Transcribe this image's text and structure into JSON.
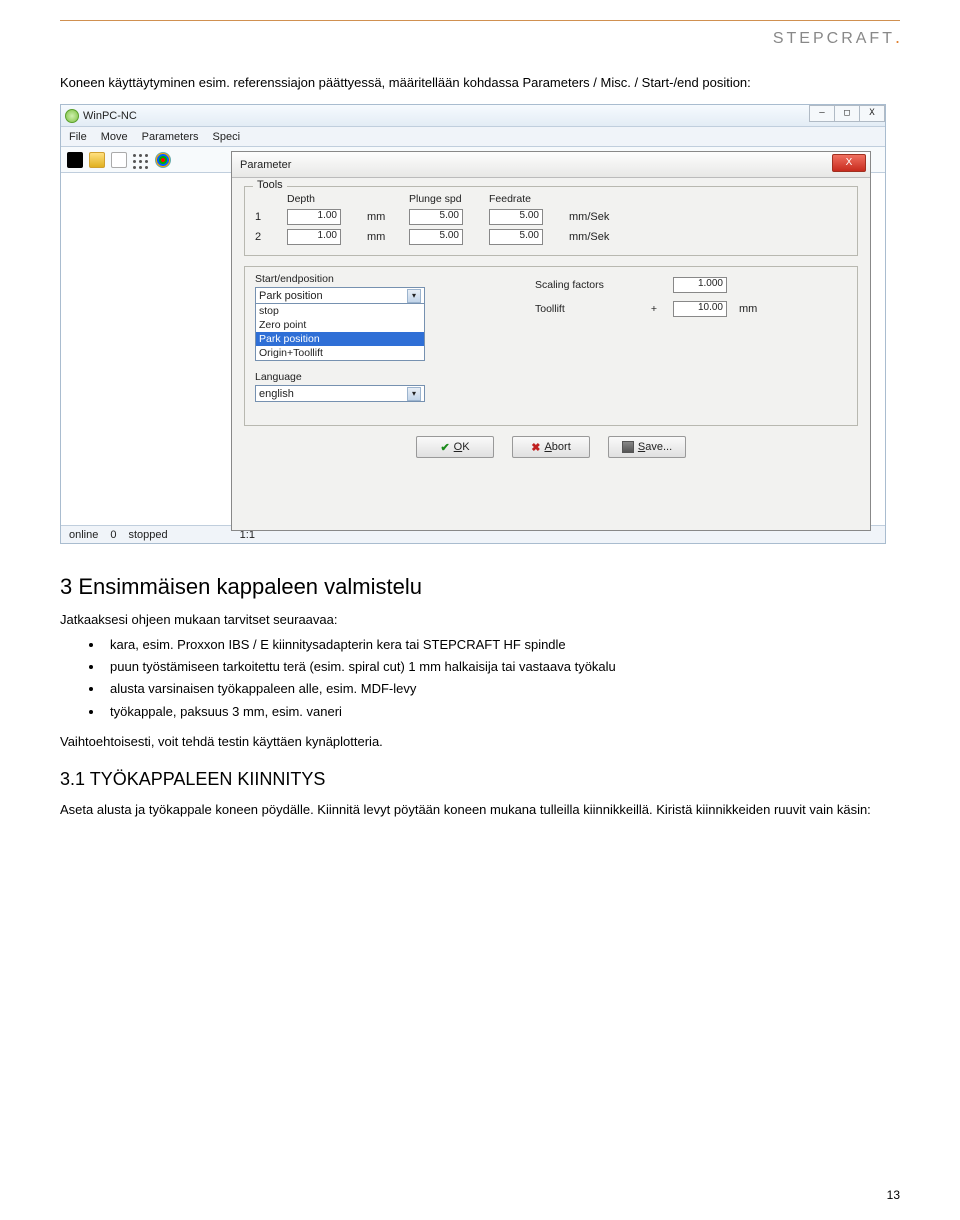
{
  "brand": "STEPCRAFT",
  "intro": "Koneen käyttäytyminen esim. referenssiajon päättyessä, määritellään kohdassa Parameters / Misc. / Start-/end position:",
  "app": {
    "title": "WinPC-NC",
    "menu": [
      "File",
      "Move",
      "Parameters",
      "Speci"
    ],
    "status": {
      "a": "online",
      "b": "0",
      "c": "stopped",
      "d": "1:1"
    }
  },
  "dialog": {
    "title": "Parameter",
    "tools_legend": "Tools",
    "headers": {
      "depth": "Depth",
      "plunge": "Plunge spd",
      "feed": "Feedrate",
      "unit_mm": "mm",
      "unit_rate": "mm/Sek"
    },
    "rows": [
      {
        "n": "1",
        "depth": "1.00",
        "plunge": "5.00",
        "feed": "5.00"
      },
      {
        "n": "2",
        "depth": "1.00",
        "plunge": "5.00",
        "feed": "5.00"
      }
    ],
    "left": {
      "startend_label": "Start/endposition",
      "combo_value": "Park position",
      "options": [
        "stop",
        "Zero point",
        "Park position",
        "Origin+Toollift"
      ],
      "selected_index": 2,
      "language_label": "Language",
      "language_value": "english"
    },
    "right": {
      "scaling_label": "Scaling factors",
      "scaling_value": "1.000",
      "toollift_label": "Toollift",
      "toollift_pre": "+",
      "toollift_value": "10.00",
      "toollift_unit": "mm"
    },
    "buttons": {
      "ok": "OK",
      "abort": "Abort",
      "save": "Save..."
    },
    "mnemonics": {
      "ok": "O",
      "abort": "A",
      "save": "S"
    }
  },
  "section": {
    "h2": "3   Ensimmäisen kappaleen valmistelu",
    "lead": "Jatkaaksesi ohjeen mukaan tarvitset seuraavaa:",
    "bullets": [
      "kara, esim. Proxxon IBS / E kiinnitysadapterin kera tai STEPCRAFT HF spindle",
      "puun työstämiseen tarkoitettu terä (esim. spiral cut) 1 mm halkaisija tai vastaava työkalu",
      "alusta varsinaisen työkappaleen alle, esim. MDF-levy",
      "työkappale, paksuus 3 mm, esim. vaneri"
    ],
    "alt": "Vaihtoehtoisesti, voit tehdä testin käyttäen kynäplotteria.",
    "h3": "3.1   TYÖKAPPALEEN KIINNITYS",
    "p1": "Aseta alusta ja työkappale koneen pöydälle. Kiinnitä levyt pöytään koneen mukana tulleilla kiinnikkeillä. Kiristä kiinnikkeiden ruuvit vain käsin:"
  },
  "pagenum": "13"
}
